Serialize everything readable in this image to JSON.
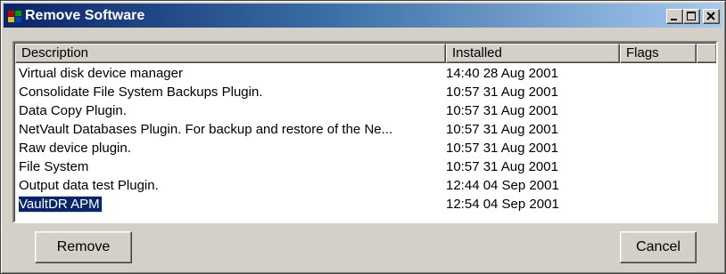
{
  "window": {
    "title": "Remove Software",
    "controls": [
      "minimize-icon",
      "maximize-icon",
      "close-icon"
    ]
  },
  "table": {
    "columns": [
      "Description",
      "Installed",
      "Flags"
    ],
    "rows": [
      {
        "description": "Virtual disk device manager",
        "installed": "14:40 28 Aug 2001",
        "flags": ""
      },
      {
        "description": "Consolidate File System Backups Plugin.",
        "installed": "10:57 31 Aug 2001",
        "flags": ""
      },
      {
        "description": "Data Copy Plugin.",
        "installed": "10:57 31 Aug 2001",
        "flags": ""
      },
      {
        "description": "NetVault Databases Plugin. For backup and restore of the Ne...",
        "installed": "10:57 31 Aug 2001",
        "flags": ""
      },
      {
        "description": "Raw device plugin.",
        "installed": "10:57 31 Aug 2001",
        "flags": ""
      },
      {
        "description": "File System",
        "installed": "10:57 31 Aug 2001",
        "flags": ""
      },
      {
        "description": "Output data test Plugin.",
        "installed": "12:44 04 Sep 2001",
        "flags": ""
      },
      {
        "description": "VaultDR APM",
        "installed": "12:54 04 Sep 2001",
        "flags": "",
        "selected": true
      }
    ]
  },
  "buttons": {
    "remove": "Remove",
    "cancel": "Cancel"
  },
  "colors": {
    "title_bar_start": "#0a246a",
    "title_bar_end": "#a6caf0",
    "selection": "#0a246a",
    "face": "#d4d0c8"
  }
}
